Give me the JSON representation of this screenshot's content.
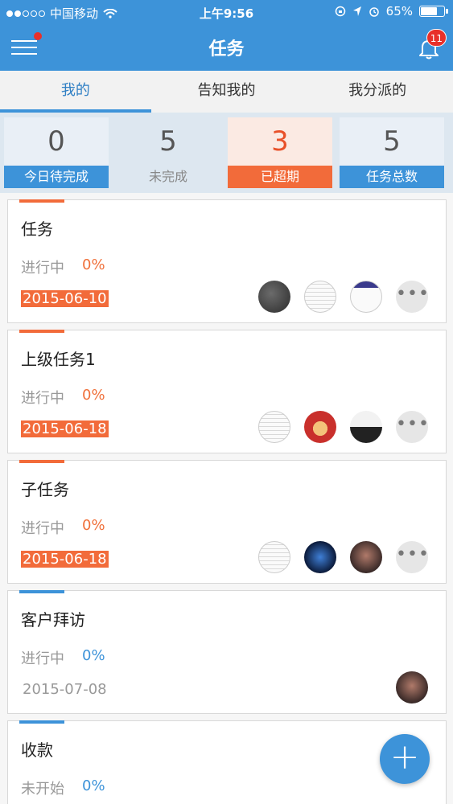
{
  "status_bar": {
    "carrier": "中国移动",
    "time": "上午9:56",
    "battery": "65%"
  },
  "header": {
    "title": "任务",
    "notification_count": "11"
  },
  "tabs": [
    {
      "label": "我的",
      "active": true
    },
    {
      "label": "告知我的",
      "active": false
    },
    {
      "label": "我分派的",
      "active": false
    }
  ],
  "stats": [
    {
      "value": "0",
      "label": "今日待完成"
    },
    {
      "value": "5",
      "label": "未完成"
    },
    {
      "value": "3",
      "label": "已超期"
    },
    {
      "value": "5",
      "label": "任务总数"
    }
  ],
  "tasks": [
    {
      "name": "任务",
      "state": "进行中",
      "progress": "0%",
      "date": "2015-06-10",
      "overdue": true
    },
    {
      "name": "上级任务1",
      "state": "进行中",
      "progress": "0%",
      "date": "2015-06-18",
      "overdue": true
    },
    {
      "name": "子任务",
      "state": "进行中",
      "progress": "0%",
      "date": "2015-06-18",
      "overdue": true
    },
    {
      "name": "客户拜访",
      "state": "进行中",
      "progress": "0%",
      "date": "2015-07-08",
      "overdue": false
    },
    {
      "name": "收款",
      "state": "未开始",
      "progress": "0%",
      "date": "",
      "overdue": false
    }
  ],
  "more_label": "•••",
  "fab_label": "+",
  "colors": {
    "primary": "#3d93d9",
    "overdue": "#f26b3a",
    "progress_overdue": "#f0703a",
    "progress_normal": "#3d93d9"
  },
  "icons": [
    "menu-icon",
    "bell-icon",
    "wifi-icon",
    "battery-icon",
    "plus-icon",
    "more-icon"
  ]
}
